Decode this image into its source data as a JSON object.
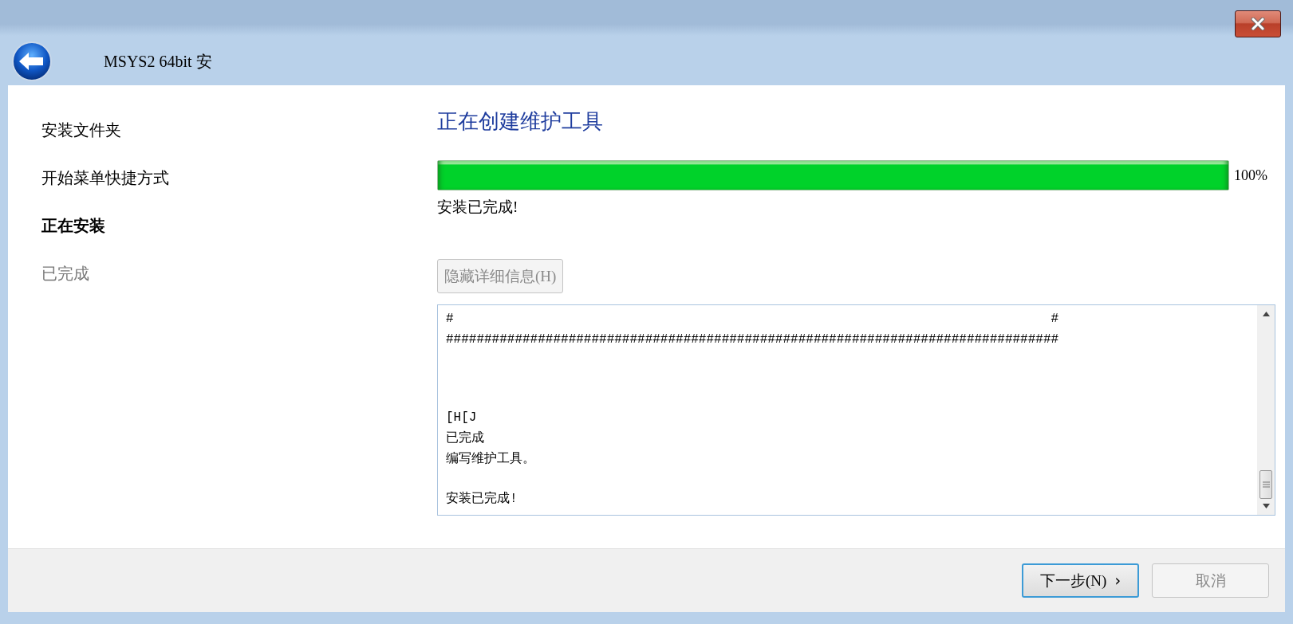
{
  "window": {
    "title": "MSYS2 64bit 安"
  },
  "steps": [
    {
      "label": "安装文件夹",
      "selected": false,
      "disabled": false
    },
    {
      "label": "开始菜单快捷方式",
      "selected": false,
      "disabled": false
    },
    {
      "label": "正在安装",
      "selected": true,
      "disabled": false
    },
    {
      "label": "已完成",
      "selected": false,
      "disabled": true
    }
  ],
  "page": {
    "heading": "正在创建维护工具",
    "progress": {
      "level": 1,
      "reading": "100%"
    },
    "status": "安装已完成!"
  },
  "details_button": {
    "label": "隐藏详细信息(H)",
    "disabled": true
  },
  "log": {
    "lines": [
      {
        "kind": "text",
        "text": "#                                                                              #"
      },
      {
        "kind": "text",
        "text": "################################################################################"
      },
      {
        "kind": "blank"
      },
      {
        "kind": "blank"
      },
      {
        "kind": "blank"
      },
      {
        "kind": "text",
        "text": "[H[J"
      },
      {
        "kind": "text",
        "text": "已完成"
      },
      {
        "kind": "text",
        "text": "编写维护工具。"
      },
      {
        "kind": "blank"
      },
      {
        "kind": "text",
        "text": "安装已完成!"
      }
    ]
  },
  "buttons": [
    {
      "label": "下一步(N)",
      "arrow": "›",
      "disabled": false,
      "focused": true
    },
    {
      "label": "取消",
      "disabled": true,
      "focused": false
    }
  ]
}
